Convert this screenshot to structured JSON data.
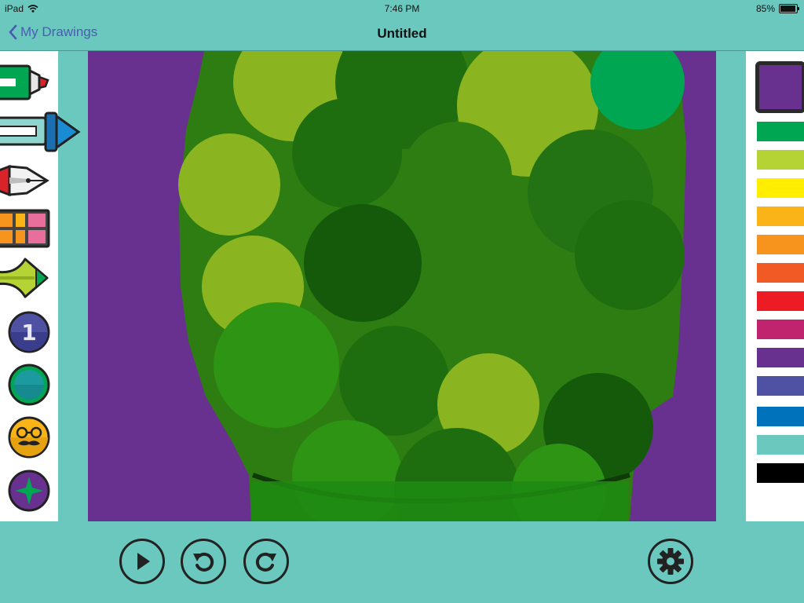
{
  "status_bar": {
    "device": "iPad",
    "time": "7:46 PM",
    "battery": "85%"
  },
  "nav": {
    "back_label": "My Drawings",
    "title": "Untitled"
  },
  "tools": [
    {
      "name": "marker-icon"
    },
    {
      "name": "crayon-icon"
    },
    {
      "name": "fountain-pen-icon"
    },
    {
      "name": "paint-box-icon"
    },
    {
      "name": "paint-brush-icon"
    },
    {
      "name": "brush-size-1-icon",
      "label": "1"
    },
    {
      "name": "teal-circle-tool-icon"
    },
    {
      "name": "glasses-mustache-face-icon"
    },
    {
      "name": "star-stamp-icon"
    }
  ],
  "selected_color": "#68308f",
  "palette": [
    "#00a651",
    "#b5d335",
    "#ffee00",
    "#fbb417",
    "#f7941d",
    "#f15a24",
    "#ed1c24",
    "#c0246e",
    "#68308f",
    "#4f52a3",
    "#0072bc",
    "#6bc8bf",
    "#000000"
  ],
  "bottom_toolbar": {
    "play": "play-icon",
    "undo": "undo-icon",
    "redo": "redo-icon",
    "settings": "gear-icon"
  }
}
